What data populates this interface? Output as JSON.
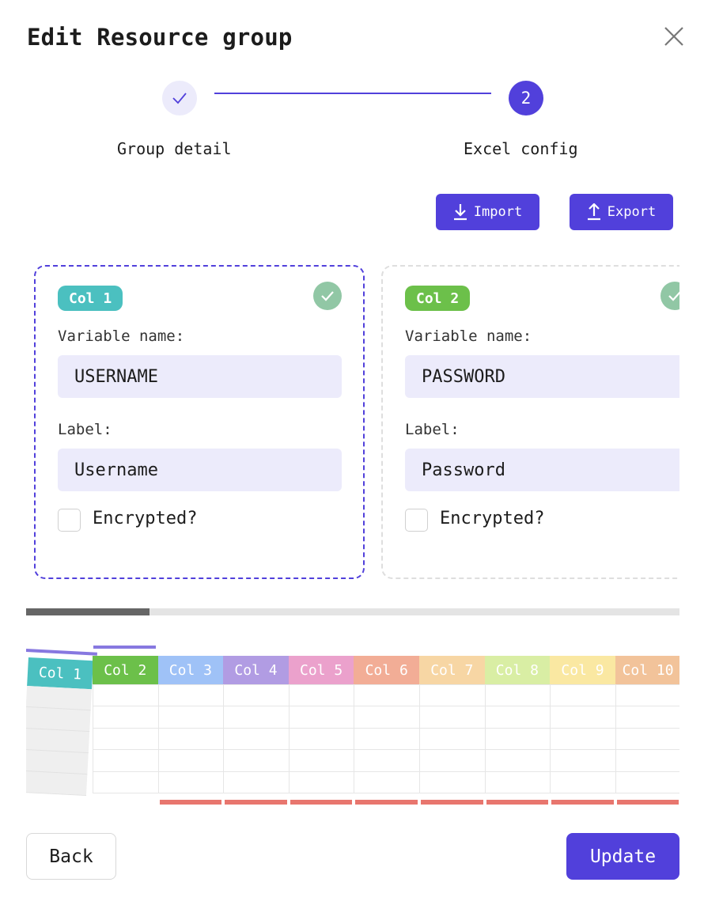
{
  "dialog": {
    "title": "Edit Resource group"
  },
  "stepper": {
    "steps": [
      {
        "label": "Group detail",
        "state": "done"
      },
      {
        "label": "Excel config",
        "number": "2",
        "state": "active"
      }
    ],
    "accent": "#5140db"
  },
  "toolbar": {
    "import_label": "Import",
    "export_label": "Export"
  },
  "cards": [
    {
      "badge": "Col 1",
      "badge_color": "#4bc0c0",
      "selected": true,
      "variable_label": "Variable name:",
      "variable_value": "USERNAME",
      "label_label": "Label:",
      "label_value": "Username",
      "encrypted_label": "Encrypted?",
      "encrypted": false
    },
    {
      "badge": "Col 2",
      "badge_color": "#6cc04a",
      "selected": false,
      "variable_label": "Variable name:",
      "variable_value": "PASSWORD",
      "label_label": "Label:",
      "label_value": "Password",
      "encrypted_label": "Encrypted?",
      "encrypted": false
    }
  ],
  "columns": [
    {
      "label": "Col 1",
      "color": "#4bc0c0"
    },
    {
      "label": "Col 2",
      "color": "#6cc04a"
    },
    {
      "label": "Col 3",
      "color": "#9fc2f7"
    },
    {
      "label": "Col 4",
      "color": "#b19ce3"
    },
    {
      "label": "Col 5",
      "color": "#eba1cc"
    },
    {
      "label": "Col 6",
      "color": "#f2ad96"
    },
    {
      "label": "Col 7",
      "color": "#f7d6a4"
    },
    {
      "label": "Col 8",
      "color": "#d9eea4"
    },
    {
      "label": "Col 9",
      "color": "#fae8a2"
    },
    {
      "label": "Col 10",
      "color": "#f2c39a"
    }
  ],
  "scroll_position": 0.19,
  "footer": {
    "back_label": "Back",
    "update_label": "Update"
  }
}
